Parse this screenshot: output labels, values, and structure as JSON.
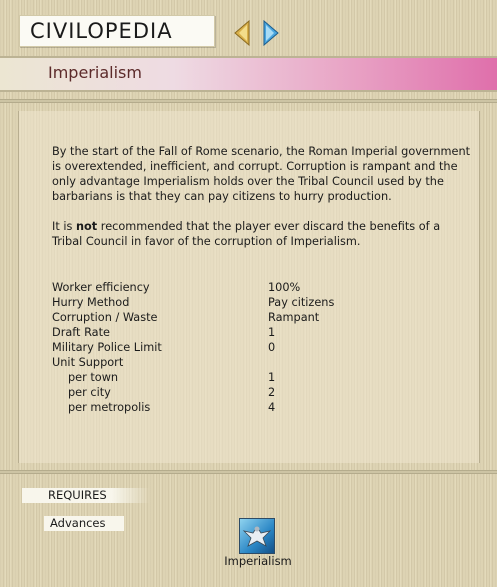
{
  "window": {
    "title": "CIVILOPEDIA"
  },
  "navigation": {
    "back_icon": "arrow-left-icon",
    "forward_icon": "arrow-right-icon",
    "back_color": "#d9b04a",
    "forward_color": "#4aa6e0"
  },
  "entry": {
    "title": "Imperialism",
    "description": [
      "By the start of the Fall of Rome scenario, the Roman Imperial government is overextended, inefficient, and corrupt.  Corruption is rampant and the only advantage Imperialism holds over the Tribal Council used by the barbarians is that they can pay citizens to hurry production.",
      "recommended that the player ever discard the benefits of a Tribal Council in favor of the corruption of Imperialism."
    ],
    "description2_prefix": "It is",
    "description2_bold": "not"
  },
  "stats": [
    {
      "label": "Worker efficiency",
      "value": "100%"
    },
    {
      "label": "Hurry Method",
      "value": "Pay citizens"
    },
    {
      "label": "Corruption / Waste",
      "value": "Rampant"
    },
    {
      "label": "Draft Rate",
      "value": "1"
    },
    {
      "label": "Military Police Limit",
      "value": "0"
    },
    {
      "label": "Unit Support",
      "value": ""
    },
    {
      "label": "per town",
      "value": "1"
    },
    {
      "label": "per city",
      "value": "2"
    },
    {
      "label": "per metropolis",
      "value": "4"
    }
  ],
  "requires": {
    "heading": "REQUIRES",
    "category": "Advances",
    "items": [
      {
        "label": "Imperialism",
        "icon": "eagle-emblem-icon"
      }
    ]
  },
  "colors": {
    "header_gradient_end": "#df6fab",
    "title_text": "#5c2a2a"
  }
}
